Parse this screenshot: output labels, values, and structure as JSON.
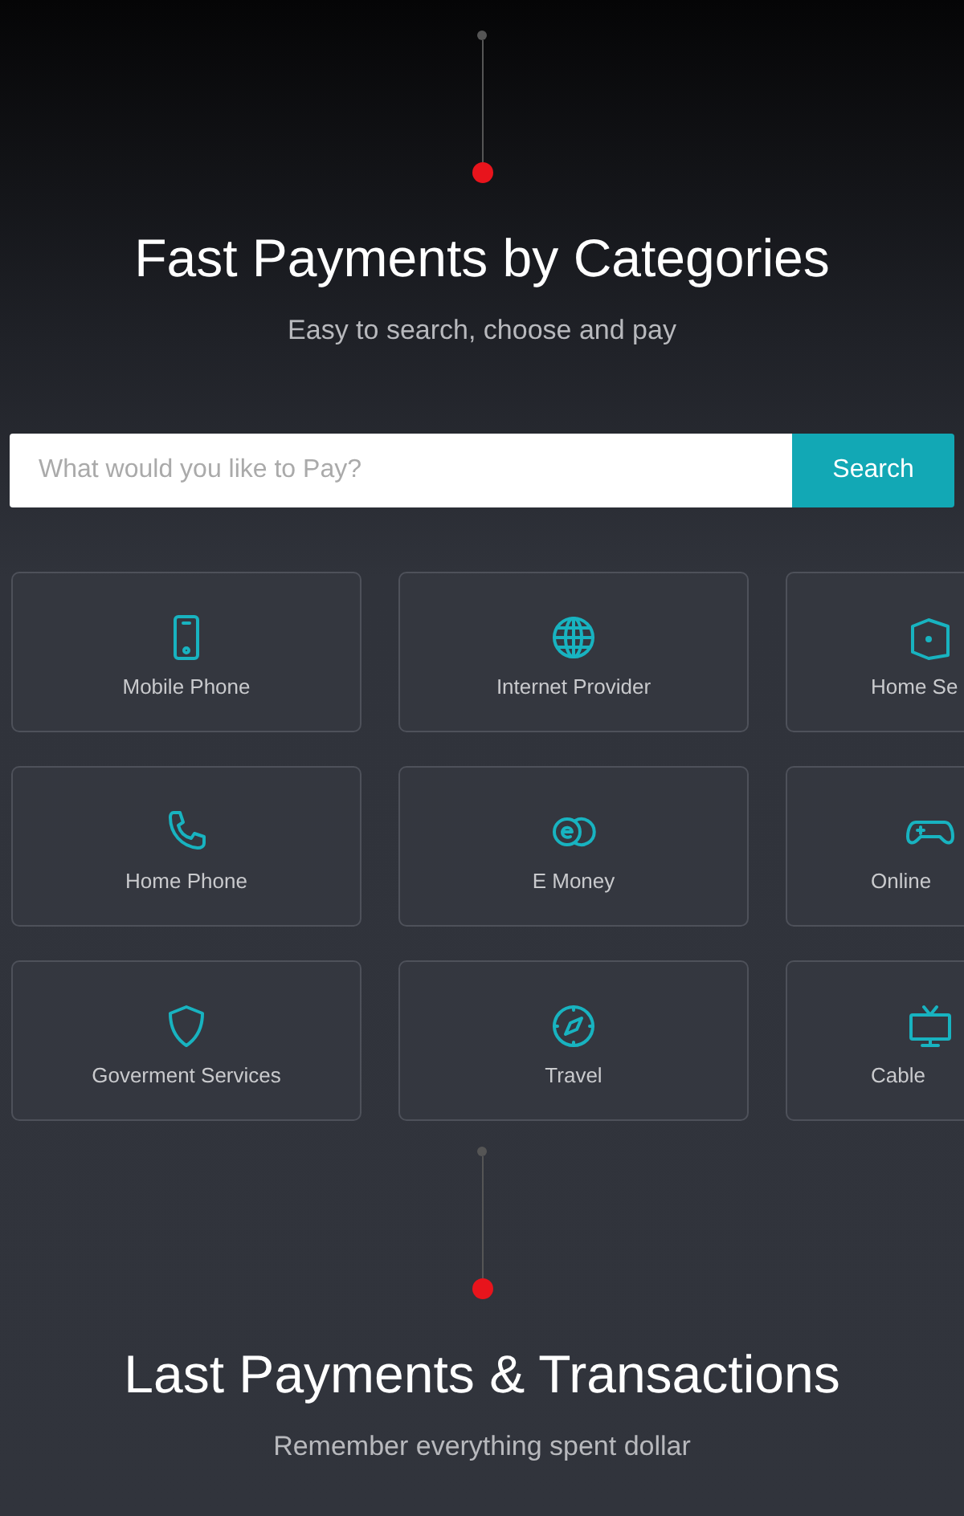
{
  "hero": {
    "title": "Fast Payments by Categories",
    "subtitle": "Easy to search, choose and pay"
  },
  "search": {
    "placeholder": "What would you like to Pay?",
    "button": "Search"
  },
  "categories": [
    {
      "label": "Mobile Phone"
    },
    {
      "label": "Internet Provider"
    },
    {
      "label": "Home Se"
    },
    {
      "label": "Home Phone"
    },
    {
      "label": "E Money"
    },
    {
      "label": "Online"
    },
    {
      "label": "Goverment Services"
    },
    {
      "label": "Travel"
    },
    {
      "label": "Cable"
    }
  ],
  "next_section": {
    "title": "Last Payments & Transactions",
    "subtitle": "Remember everything spent dollar"
  }
}
